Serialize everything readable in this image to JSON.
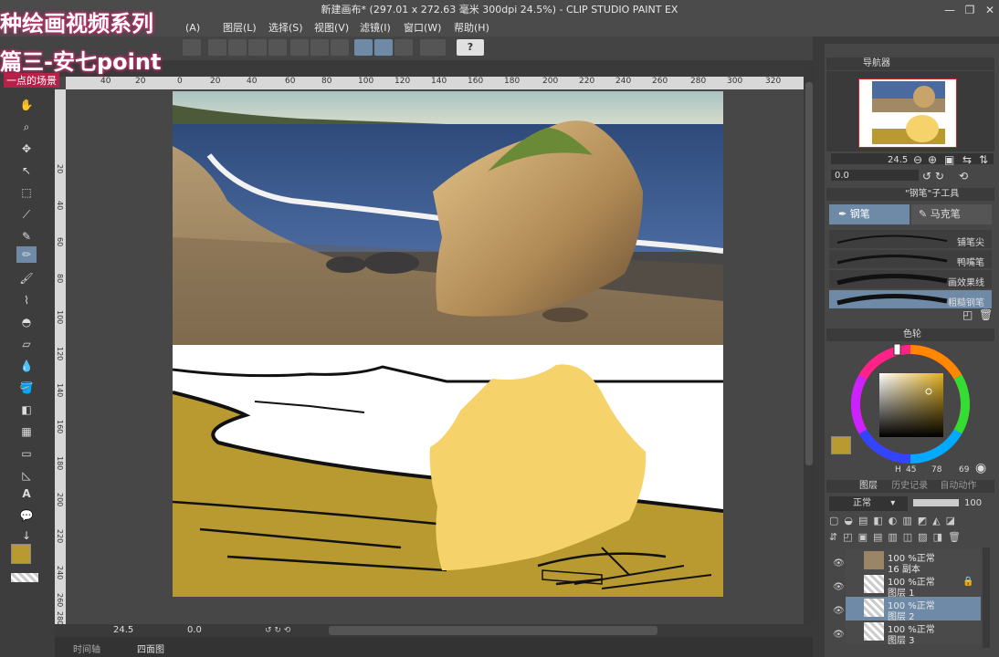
{
  "window": {
    "title": "新建画布* (297.01 x 272.63 毫米 300dpi 24.5%) - CLIP STUDIO PAINT EX",
    "controls": [
      "minimize-icon",
      "restore-icon",
      "close-icon"
    ]
  },
  "overlay": {
    "caption_line1": "种绘画视频系列",
    "caption_line2": "篇三-安七point",
    "caption_line3": "一点的场景"
  },
  "menu": {
    "items": [
      "(A)",
      "图层(L)",
      "选择(S)",
      "视图(V)",
      "滤镜(I)",
      "窗口(W)",
      "帮助(H)"
    ]
  },
  "ruler": {
    "top": [
      "40",
      "20",
      "0",
      "20",
      "40",
      "60",
      "80",
      "100",
      "120",
      "140",
      "160",
      "180",
      "200",
      "220",
      "240",
      "260",
      "280",
      "300",
      "320"
    ],
    "left": [
      "20",
      "40",
      "60",
      "80",
      "100",
      "120",
      "140",
      "160",
      "180",
      "200",
      "220",
      "240",
      "260",
      "280"
    ]
  },
  "navigator": {
    "title": "导航器",
    "zoom": "24.5",
    "rotation": "0.0"
  },
  "subtool": {
    "header": "\"钢笔\"子工具",
    "tabs": [
      "钢笔",
      "马克笔"
    ],
    "brushes": [
      "铺笔尖",
      "鸭嘴笔",
      "画效果线",
      "粗糙钢笔"
    ]
  },
  "color": {
    "header": "色轮",
    "main": "#b89a30",
    "sub": "#ffffff",
    "h": "45",
    "s": "78",
    "v": "69"
  },
  "layers": {
    "tabs": [
      "图层",
      "历史记录",
      "自动动作"
    ],
    "blend_mode": "正常",
    "opacity": "100",
    "items": [
      {
        "opacity": "100 %",
        "mode": "正常",
        "name": "16 副本"
      },
      {
        "opacity": "100 %",
        "mode": "正常",
        "name": "图层 1"
      },
      {
        "opacity": "100 %",
        "mode": "正常",
        "name": "图层 2"
      },
      {
        "opacity": "100 %",
        "mode": "正常",
        "name": "图层 3"
      }
    ]
  },
  "status": {
    "zoom": "24.5",
    "rotation": "0.0",
    "tabs": [
      "时间轴",
      "四面图"
    ]
  },
  "colors": {
    "sand": "#b89a30",
    "rock_fill": "#f6d36a",
    "accent": "#6e8aa6"
  }
}
